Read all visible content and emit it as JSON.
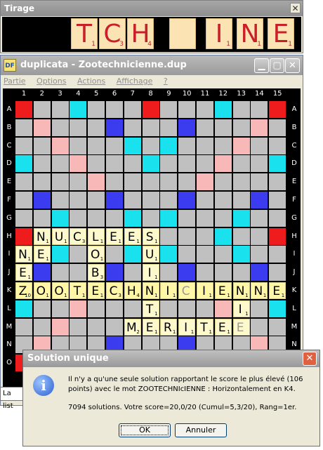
{
  "tirage": {
    "title": "Tirage",
    "close": "✕",
    "tiles": [
      {
        "letter": "T",
        "score": "1"
      },
      {
        "letter": "C",
        "score": "3"
      },
      {
        "letter": "H",
        "score": "4"
      },
      {
        "letter": "",
        "score": ""
      },
      {
        "letter": "I",
        "score": "1"
      },
      {
        "letter": "N",
        "score": "1"
      },
      {
        "letter": "E",
        "score": "1"
      }
    ]
  },
  "main": {
    "app_icon": "DF",
    "title": "duplicata - Zootechnicienne.dup",
    "minimize": "▁",
    "maximize": "▢",
    "close": "✕",
    "menu": [
      "Partie",
      "Options",
      "Actions",
      "Affichage",
      "?"
    ],
    "columns": [
      "1",
      "2",
      "3",
      "4",
      "5",
      "6",
      "7",
      "8",
      "9",
      "10",
      "11",
      "12",
      "13",
      "14",
      "15"
    ],
    "rows": [
      "A",
      "B",
      "C",
      "D",
      "E",
      "F",
      "G",
      "H",
      "I",
      "J",
      "K",
      "L",
      "M",
      "N",
      "O"
    ],
    "words": [
      {
        "row": 7,
        "col": 1,
        "letters": [
          "N",
          "U",
          "C",
          "L",
          "E",
          "E",
          "S"
        ],
        "scores": [
          "1",
          "1",
          "3",
          "1",
          "1",
          "1",
          "1"
        ]
      },
      {
        "row": 8,
        "col": 0,
        "letters": [
          "N"
        ],
        "scores": [
          "1"
        ]
      },
      {
        "row": 8,
        "col": 1,
        "letters": [
          "E"
        ],
        "scores": [
          "1"
        ]
      },
      {
        "row": 9,
        "col": 0,
        "letters": [
          "E"
        ],
        "scores": [
          "1"
        ]
      },
      {
        "row": 8,
        "col": 4,
        "letters": [
          "O"
        ],
        "scores": [
          "1"
        ]
      },
      {
        "row": 9,
        "col": 4,
        "letters": [
          "B"
        ],
        "scores": [
          "3"
        ]
      },
      {
        "row": 8,
        "col": 7,
        "letters": [
          "U"
        ],
        "scores": [
          "1"
        ]
      },
      {
        "row": 9,
        "col": 7,
        "letters": [
          "I"
        ],
        "scores": [
          "1"
        ]
      },
      {
        "row": 10,
        "col": 0,
        "letters": [
          "Z",
          "O",
          "O",
          "T",
          "E",
          "C",
          "H",
          "N",
          "I",
          "C",
          "I",
          "E",
          "N",
          "N",
          "E"
        ],
        "scores": [
          "10",
          "1",
          "1",
          "1",
          "1",
          "3",
          "4",
          "1",
          "1",
          "",
          "1",
          "1",
          "1",
          "1",
          "1"
        ]
      },
      {
        "row": 11,
        "col": 7,
        "letters": [
          "T"
        ],
        "scores": [
          "1"
        ]
      },
      {
        "row": 11,
        "col": 12,
        "letters": [
          "I"
        ],
        "scores": [
          "1"
        ]
      },
      {
        "row": 12,
        "col": 6,
        "letters": [
          "M",
          "E",
          "R",
          "I",
          "T",
          "E",
          "E"
        ],
        "scores": [
          "2",
          "1",
          "1",
          "1",
          "1",
          "1",
          ""
        ]
      }
    ],
    "status_text": "La list"
  },
  "dialog": {
    "title": "Solution unique",
    "close": "✕",
    "icon": "i",
    "message": "Il n'y a qu'une seule solution rapportant le score le plus élevé (106 points) avec le mot ZOOTECHNICIENNE : Horizontalement en K4.",
    "message_display": "Il n'y a qu'une seule solution rapportant le score le plus élevé (106 points) avec le mot ZOOTECHNIcIENNE : Horizontalement en K4.",
    "stats": "7094 solutions. Votre score=20,0/20 (Cumul=5,3/20), Rang=1er.",
    "ok": "OK",
    "cancel": "Annuler"
  }
}
